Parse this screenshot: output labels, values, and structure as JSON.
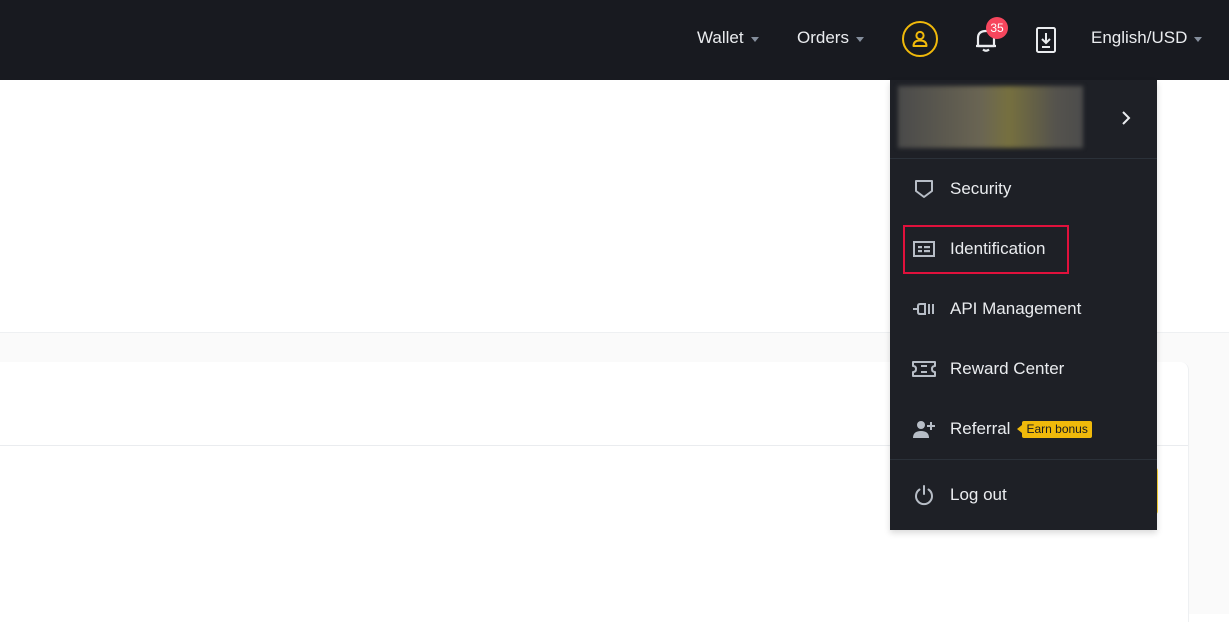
{
  "header": {
    "wallet_label": "Wallet",
    "orders_label": "Orders",
    "notifications_count": "35",
    "language_label": "English/USD",
    "icons": [
      "user-icon",
      "bell-icon",
      "download-icon"
    ],
    "accent_color": "#f0b90b",
    "badge_color": "#f6465d"
  },
  "user_menu": {
    "items": [
      {
        "label": "Security",
        "icon": "shield-icon"
      },
      {
        "label": "Identification",
        "icon": "id-card-icon"
      },
      {
        "label": "API Management",
        "icon": "api-plug-icon"
      },
      {
        "label": "Reward Center",
        "icon": "ticket-icon"
      },
      {
        "label": "Referral",
        "icon": "add-user-icon",
        "badge": "Earn bonus"
      }
    ],
    "logout_label": "Log out",
    "highlight_color": "#e0113c"
  }
}
